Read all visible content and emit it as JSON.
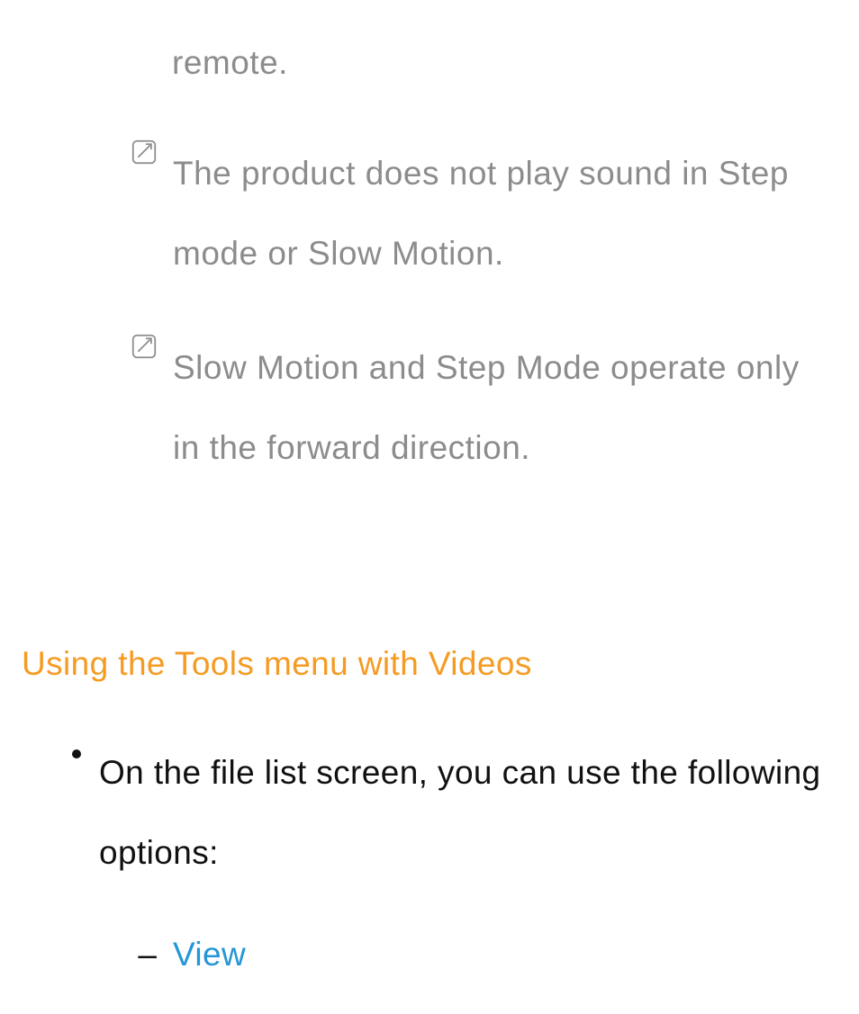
{
  "fragment": "remote.",
  "notes": [
    "The product does not play sound in Step mode or Slow Motion.",
    "Slow Motion and Step Mode operate only in the forward direction."
  ],
  "section_heading": "Using the Tools menu with Videos",
  "bullet_intro": "On the file list screen, you can use the following options:",
  "sub_items": [
    "View"
  ]
}
